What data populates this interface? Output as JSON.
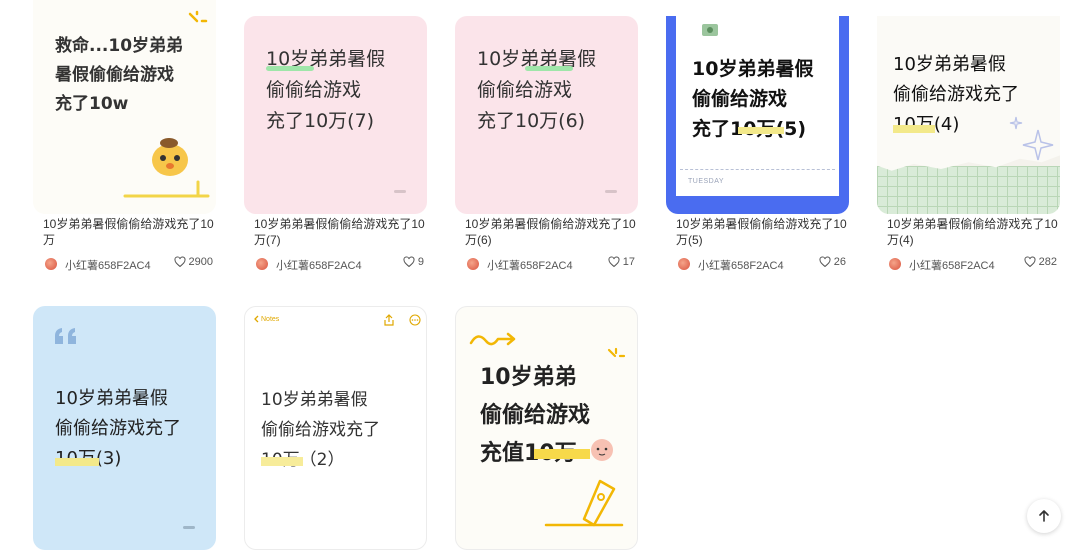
{
  "notes": [
    {
      "cover_text": "救命...10岁弟弟\n暑假偷偷给游戏\n充了10w",
      "title": "10岁弟弟暑假偷偷给游戏充了10万",
      "author": "小红薯658F2AC4",
      "likes": "2900"
    },
    {
      "cover_text": "10岁弟弟暑假\n偷偷给游戏\n充了10万(7)",
      "title": "10岁弟弟暑假偷偷给游戏充了10万(7)",
      "author": "小红薯658F2AC4",
      "likes": "9"
    },
    {
      "cover_text": "10岁弟弟暑假\n偷偷给游戏\n充了10万(6)",
      "title": "10岁弟弟暑假偷偷给游戏充了10万(6)",
      "author": "小红薯658F2AC4",
      "likes": "17"
    },
    {
      "cover_text": "10岁弟弟暑假\n偷偷给游戏\n充了10万(5)",
      "cover_footer": "TUESDAY",
      "title": "10岁弟弟暑假偷偷给游戏充了10万(5)",
      "author": "小红薯658F2AC4",
      "likes": "26"
    },
    {
      "cover_text": "10岁弟弟暑假\n偷偷给游戏充了\n10万(4)",
      "title": "10岁弟弟暑假偷偷给游戏充了10万(4)",
      "author": "小红薯658F2AC4",
      "likes": "282"
    },
    {
      "cover_text": "10岁弟弟暑假\n偷偷给游戏充了\n10万(3)"
    },
    {
      "cover_header": "Notes",
      "cover_text": "10岁弟弟暑假\n偷偷给游戏充了\n10万（2）"
    },
    {
      "cover_text": "10岁弟弟\n偷偷给游戏\n充值10万"
    }
  ],
  "colors": {
    "pink_cover": "#fbe4ea",
    "blue_cover": "#cfe7f8",
    "ticket_border": "#4a6cf0",
    "highlight_yellow": "#fbe37a",
    "highlight_green": "#9fe6a9"
  },
  "icons": [
    "heart-icon",
    "arrow-up-icon",
    "share-icon",
    "more-icon",
    "chevron-left-icon",
    "quote-icon",
    "sparkle-icon",
    "pen-icon"
  ]
}
